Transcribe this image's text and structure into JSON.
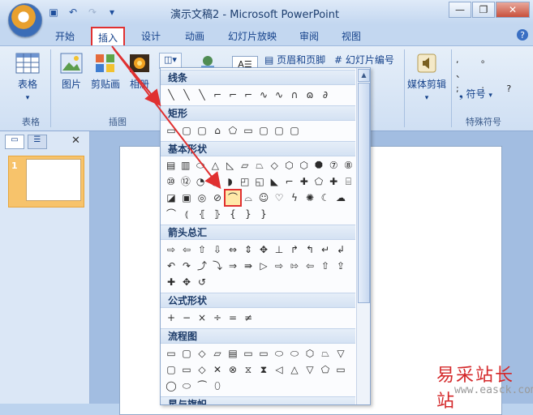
{
  "window": {
    "title": "演示文稿2 - Microsoft PowerPoint"
  },
  "tabs": [
    {
      "label": "开始"
    },
    {
      "label": "插入"
    },
    {
      "label": "设计"
    },
    {
      "label": "动画"
    },
    {
      "label": "幻灯片放映"
    },
    {
      "label": "审阅"
    },
    {
      "label": "视图"
    }
  ],
  "ribbon": {
    "table_label": "表格",
    "table_group": "表格",
    "picture_label": "图片",
    "clipart_label": "剪贴画",
    "album_label": "相册",
    "illus_group": "插图",
    "header_footer_label": "页眉和页脚",
    "slide_number_label": "幻灯片编号",
    "media_label": "媒体剪辑",
    "symbol_label": "符号",
    "special_group": "特殊符号"
  },
  "slides": [
    {
      "number": "1"
    }
  ],
  "gallery": {
    "categories": {
      "lines": "线条",
      "rect": "矩形",
      "basic": "基本形状",
      "arrows": "箭头总汇",
      "equation": "公式形状",
      "flowchart": "流程图",
      "stars": "星与旗帜"
    },
    "rows": {
      "lines": [
        "╲",
        "╲",
        "╲",
        "⌐",
        "⌐",
        "⌐",
        "∿",
        "∿",
        "∩",
        "ɷ",
        "∂"
      ],
      "rect": [
        "▭",
        "▢",
        "▢",
        "⌂",
        "⬠",
        "▭",
        "▢",
        "▢",
        "▢"
      ],
      "basic1": [
        "▤",
        "▥",
        "⬭",
        "△",
        "◺",
        "▱",
        "⏢",
        "◇",
        "⬡",
        "⬡",
        "⯃",
        "⑦",
        "⑧"
      ],
      "basic2": [
        "⑩",
        "⑫",
        "◔",
        "◕",
        "◗",
        "◰",
        "◱",
        "◣",
        "⌐",
        "✚",
        "⬠",
        "✚",
        "⌸"
      ],
      "basic3": [
        "◪",
        "▣",
        "◎",
        "⊘",
        "⌒",
        "⌓",
        "☺",
        "♡",
        "ϟ",
        "✺",
        "☾",
        "☁"
      ],
      "basic4": [
        "⌒",
        "⦅",
        "⦃",
        "⦄",
        "{",
        "}",
        "}"
      ],
      "arrows1": [
        "⇨",
        "⇦",
        "⇧",
        "⇩",
        "⇔",
        "⇕",
        "✥",
        "⊥",
        "↱",
        "↰",
        "↵",
        "↲"
      ],
      "arrows2": [
        "↶",
        "↷",
        "⤴",
        "⤵",
        "⇒",
        "⇛",
        "▷",
        "⇨",
        "⇰",
        "⇦",
        "⇧",
        "⇪"
      ],
      "arrows3": [
        "✚",
        "✥",
        "↺"
      ],
      "equation": [
        "+",
        "−",
        "×",
        "÷",
        "=",
        "≠"
      ],
      "flow1": [
        "▭",
        "▢",
        "◇",
        "▱",
        "▤",
        "▭",
        "▭",
        "⬭",
        "⬭",
        "⬡",
        "⏢",
        "▽"
      ],
      "flow2": [
        "▢",
        "▭",
        "◇",
        "✕",
        "⊗",
        "⧖",
        "⧗",
        "◁",
        "△",
        "▽",
        "⬠",
        "▭"
      ],
      "flow3": [
        "◯",
        "⬭",
        "⏜",
        "⬯"
      ]
    }
  },
  "icons": {
    "office": "office-button-icon",
    "save": "save-icon",
    "undo": "undo-icon",
    "redo": "redo-icon",
    "customize": "customize-qat-icon",
    "help": "help-icon"
  },
  "watermark": {
    "cn": "易采站长站",
    "url": "www.easck.com"
  },
  "colors": {
    "highlight": "#e03030",
    "accent": "#15428b"
  }
}
